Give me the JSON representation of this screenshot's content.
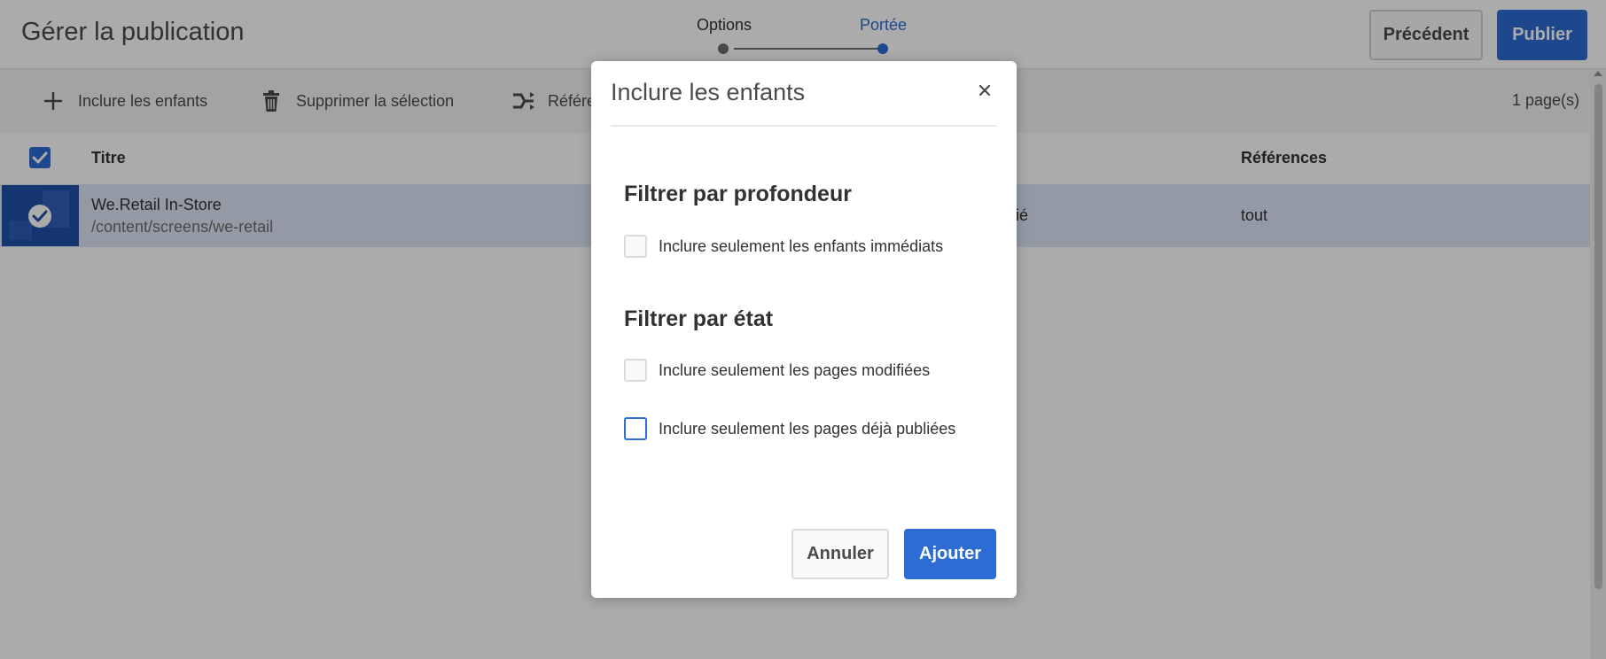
{
  "header": {
    "title": "Gérer la publication",
    "steps": [
      {
        "label": "Options",
        "state": "done"
      },
      {
        "label": "Portée",
        "state": "current"
      }
    ],
    "prev_label": "Précédent",
    "publish_label": "Publier"
  },
  "toolbar": {
    "include_children_label": "Inclure les enfants",
    "remove_selection_label": "Supprimer la sélection",
    "references_label": "Référe",
    "page_count": "1 page(s)"
  },
  "table": {
    "columns": {
      "title": "Titre",
      "references": "Références"
    },
    "rows": [
      {
        "title": "We.Retail In-Store",
        "path": "/content/screens/we-retail",
        "status": "blié",
        "references": "tout",
        "selected": true
      }
    ]
  },
  "dialog": {
    "title": "Inclure les enfants",
    "depth_heading": "Filtrer par profondeur",
    "immediate_children_label": "Inclure seulement les enfants immédiats",
    "state_heading": "Filtrer par état",
    "modified_pages_label": "Inclure seulement les pages modifiées",
    "published_pages_label": "Inclure seulement les pages déjà publiées",
    "cancel_label": "Annuler",
    "add_label": "Ajouter"
  },
  "colors": {
    "accent": "#2d6cd4",
    "selected_row": "#dbe6f6",
    "step_done": "#6e6e6e",
    "step_current": "#2d6cd4"
  }
}
